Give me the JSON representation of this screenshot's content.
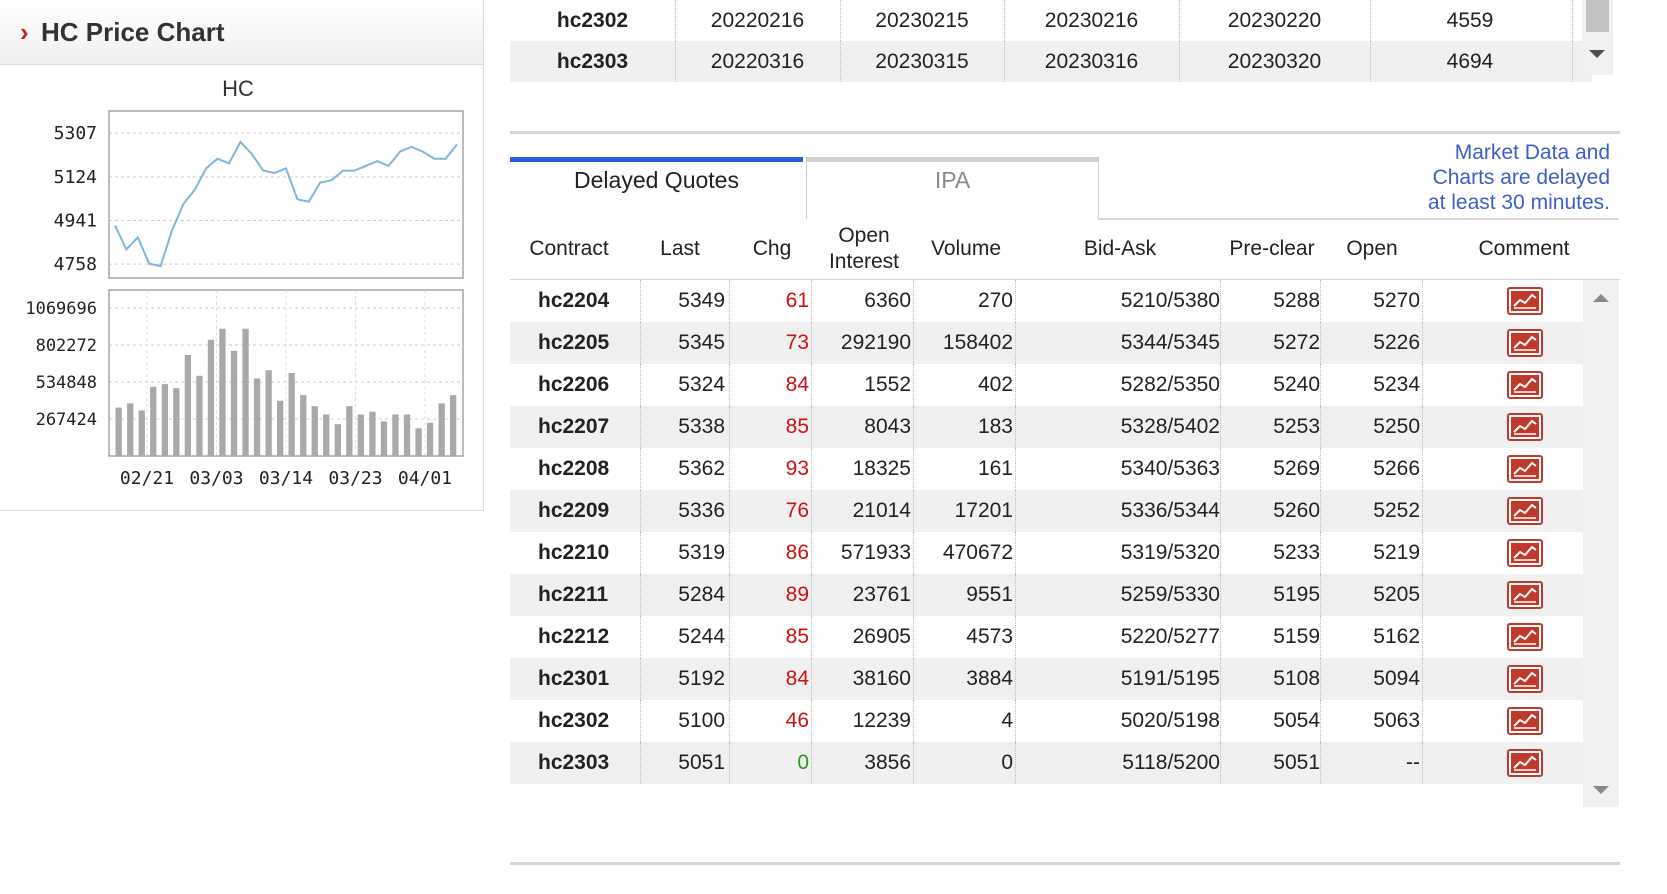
{
  "panel": {
    "title": "HC Price Chart"
  },
  "chart_data": [
    {
      "type": "line",
      "title": "HC",
      "ylim": [
        4700,
        5400
      ],
      "y_ticks": [
        "5307",
        "5124",
        "4941",
        "4758"
      ],
      "values": [
        4920,
        4820,
        4870,
        4760,
        4750,
        4900,
        5010,
        5070,
        5160,
        5200,
        5180,
        5270,
        5220,
        5150,
        5140,
        5160,
        5030,
        5020,
        5100,
        5110,
        5150,
        5150,
        5170,
        5190,
        5170,
        5230,
        5250,
        5230,
        5200,
        5200,
        5260
      ],
      "grid": true
    },
    {
      "type": "bar",
      "x_tick_labels": [
        "02/21",
        "03/03",
        "03/14",
        "03/23",
        "04/01"
      ],
      "y_ticks": [
        "1069696",
        "802272",
        "534848",
        "267424"
      ],
      "ylim": [
        0,
        1200000
      ],
      "values": [
        350000,
        380000,
        330000,
        500000,
        520000,
        490000,
        730000,
        580000,
        840000,
        920000,
        760000,
        920000,
        560000,
        620000,
        400000,
        600000,
        440000,
        360000,
        300000,
        230000,
        360000,
        300000,
        320000,
        250000,
        300000,
        300000,
        200000,
        240000,
        380000,
        440000
      ],
      "grid": true
    }
  ],
  "top_table": {
    "rows": [
      [
        "hc2302",
        "20220216",
        "20230215",
        "20230216",
        "20230220",
        "4559"
      ],
      [
        "hc2303",
        "20220316",
        "20230315",
        "20230316",
        "20230320",
        "4694"
      ]
    ]
  },
  "tabs": {
    "delayed": "Delayed Quotes",
    "ipa": "IPA"
  },
  "delay_note": [
    "Market Data and",
    "Charts are delayed",
    "at least 30 minutes."
  ],
  "quotes": {
    "headers": {
      "contract": "Contract",
      "last": "Last",
      "chg": "Chg",
      "open_interest_1": "Open",
      "open_interest_2": "Interest",
      "volume": "Volume",
      "bid_ask": "Bid-Ask",
      "pre_clear": "Pre-clear",
      "open": "Open",
      "comment": "Comment"
    },
    "rows": [
      {
        "contract": "hc2204",
        "last": "5349",
        "chg": "61",
        "oi": "6360",
        "volume": "270",
        "bid_ask": "5210/5380",
        "pre_clear": "5288",
        "open": "5270"
      },
      {
        "contract": "hc2205",
        "last": "5345",
        "chg": "73",
        "oi": "292190",
        "volume": "158402",
        "bid_ask": "5344/5345",
        "pre_clear": "5272",
        "open": "5226"
      },
      {
        "contract": "hc2206",
        "last": "5324",
        "chg": "84",
        "oi": "1552",
        "volume": "402",
        "bid_ask": "5282/5350",
        "pre_clear": "5240",
        "open": "5234"
      },
      {
        "contract": "hc2207",
        "last": "5338",
        "chg": "85",
        "oi": "8043",
        "volume": "183",
        "bid_ask": "5328/5402",
        "pre_clear": "5253",
        "open": "5250"
      },
      {
        "contract": "hc2208",
        "last": "5362",
        "chg": "93",
        "oi": "18325",
        "volume": "161",
        "bid_ask": "5340/5363",
        "pre_clear": "5269",
        "open": "5266"
      },
      {
        "contract": "hc2209",
        "last": "5336",
        "chg": "76",
        "oi": "21014",
        "volume": "17201",
        "bid_ask": "5336/5344",
        "pre_clear": "5260",
        "open": "5252"
      },
      {
        "contract": "hc2210",
        "last": "5319",
        "chg": "86",
        "oi": "571933",
        "volume": "470672",
        "bid_ask": "5319/5320",
        "pre_clear": "5233",
        "open": "5219"
      },
      {
        "contract": "hc2211",
        "last": "5284",
        "chg": "89",
        "oi": "23761",
        "volume": "9551",
        "bid_ask": "5259/5330",
        "pre_clear": "5195",
        "open": "5205"
      },
      {
        "contract": "hc2212",
        "last": "5244",
        "chg": "85",
        "oi": "26905",
        "volume": "4573",
        "bid_ask": "5220/5277",
        "pre_clear": "5159",
        "open": "5162"
      },
      {
        "contract": "hc2301",
        "last": "5192",
        "chg": "84",
        "oi": "38160",
        "volume": "3884",
        "bid_ask": "5191/5195",
        "pre_clear": "5108",
        "open": "5094"
      },
      {
        "contract": "hc2302",
        "last": "5100",
        "chg": "46",
        "oi": "12239",
        "volume": "4",
        "bid_ask": "5020/5198",
        "pre_clear": "5054",
        "open": "5063"
      },
      {
        "contract": "hc2303",
        "last": "5051",
        "chg": "0",
        "oi": "3856",
        "volume": "0",
        "bid_ask": "5118/5200",
        "pre_clear": "5051",
        "open": "--"
      }
    ]
  },
  "colors": {
    "accent_tab": "#2a5bd7",
    "chg_positive": "#d01010",
    "chg_zero": "#2d9a1f",
    "line": "#7fb6dd",
    "bar": "#a9a9a9",
    "chart_icon": "#c0392b"
  },
  "icons": {
    "chevron": "chevron-right-icon",
    "row_chart": "line-chart-icon"
  }
}
